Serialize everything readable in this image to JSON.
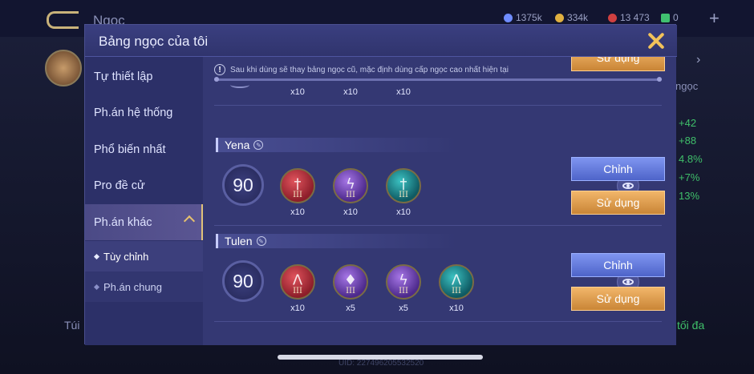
{
  "background": {
    "title": "Ngọc",
    "resources": [
      {
        "value": "1375k",
        "color": "#6f8cff"
      },
      {
        "value": "334k",
        "color": "#e0b040"
      },
      {
        "value": "13 473",
        "color": "#d04040"
      },
      {
        "value": "0",
        "color": "#40c070"
      }
    ],
    "side_label": "ngọc",
    "stats": [
      "+42",
      "+88",
      "4.8%",
      "+7%",
      "13%"
    ],
    "bottom_left": "Túi",
    "bottom_right": "tối đa",
    "uid": "UID: 227496205532520"
  },
  "modal": {
    "title": "Bảng ngọc của tôi",
    "menu": {
      "items": [
        {
          "label": "Tự thiết lập"
        },
        {
          "label": "Ph.án hệ thống"
        },
        {
          "label": "Phổ biến nhất"
        },
        {
          "label": "Pro đề cử"
        },
        {
          "label": "Ph.án khác"
        }
      ],
      "sub_items": [
        {
          "label": "Tùy chỉnh"
        },
        {
          "label": "Ph.án chung"
        }
      ]
    },
    "notice": "Sau khi dùng sẽ thay bảng ngọc cũ, mặc định dùng cấp ngọc cao nhất hiện tại",
    "partial_row": {
      "counts": [
        "x10",
        "x10",
        "x10"
      ],
      "use_label": "Sử dụng"
    },
    "loadouts": [
      {
        "name": "Yena",
        "level": "90",
        "gems": [
          {
            "icon": "red-sword-gem-icon",
            "tier": "III",
            "count": "x10"
          },
          {
            "icon": "purple-bolt-gem-icon",
            "tier": "III",
            "count": "x10"
          },
          {
            "icon": "teal-sword-gem-icon",
            "tier": "III",
            "count": "x10"
          }
        ],
        "edit_label": "Chỉnh",
        "use_label": "Sử dụng"
      },
      {
        "name": "Tulen",
        "level": "90",
        "gems": [
          {
            "icon": "red-claw-gem-icon",
            "tier": "III",
            "count": "x10"
          },
          {
            "icon": "purple-drop-gem-icon",
            "tier": "III",
            "count": "x5"
          },
          {
            "icon": "purple-bolt-gem-icon",
            "tier": "III",
            "count": "x5"
          },
          {
            "icon": "teal-claw-gem-icon",
            "tier": "III",
            "count": "x10"
          }
        ],
        "edit_label": "Chỉnh",
        "use_label": "Sử dụng"
      }
    ]
  }
}
